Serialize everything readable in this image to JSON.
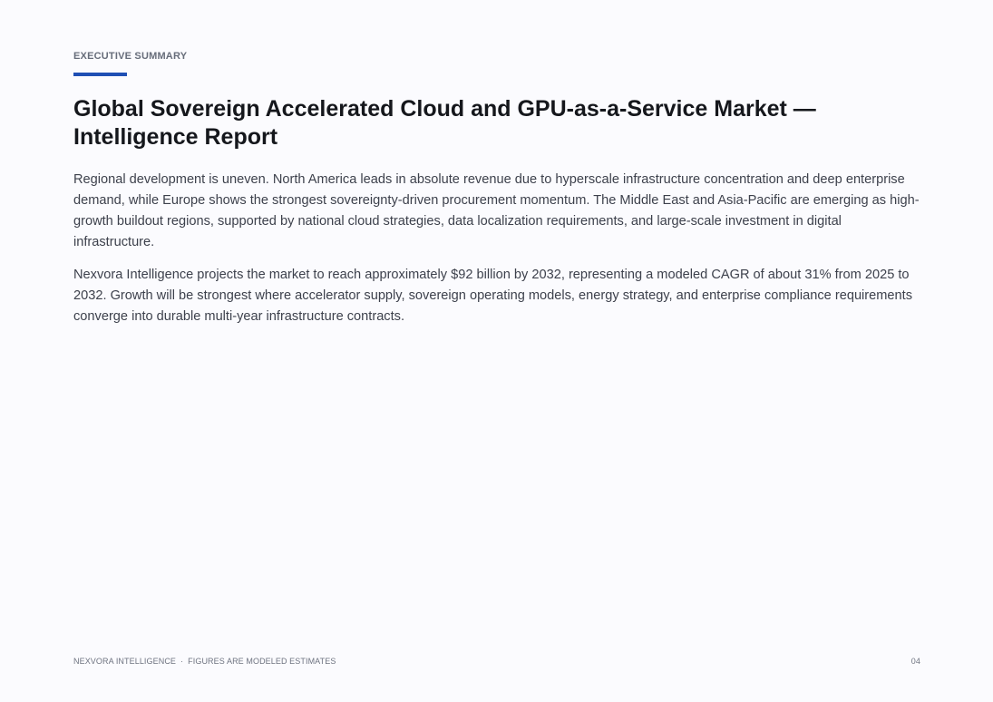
{
  "header": {
    "eyebrow": "EXECUTIVE SUMMARY",
    "title": "Global Sovereign Accelerated Cloud and GPU-as-a-Service Market — Intelligence Report"
  },
  "content": {
    "paragraphs": [
      "Regional development is uneven. North America leads in absolute revenue due to hyperscale infrastructure concentration and deep enterprise demand, while Europe shows the strongest sovereignty-driven procurement momentum. The Middle East and Asia-Pacific are emerging as high-growth buildout regions, supported by national cloud strategies, data localization requirements, and large-scale investment in digital infrastructure.",
      "Nexvora Intelligence projects the market to reach approximately $92 billion by 2032, representing a modeled CAGR of about 31% from 2025 to 2032. Growth will be strongest where accelerator supply, sovereign operating models, energy strategy, and enterprise compliance requirements converge into durable multi-year infrastructure contracts."
    ]
  },
  "footer": {
    "brand": "NEXVORA INTELLIGENCE",
    "separator": "·",
    "note": "FIGURES ARE MODELED ESTIMATES",
    "page_number": "04"
  },
  "colors": {
    "accent": "#1f4fb4",
    "background": "#fbfbfe",
    "title": "#15171c",
    "body_text": "#3d414c",
    "muted": "#676d7a"
  }
}
